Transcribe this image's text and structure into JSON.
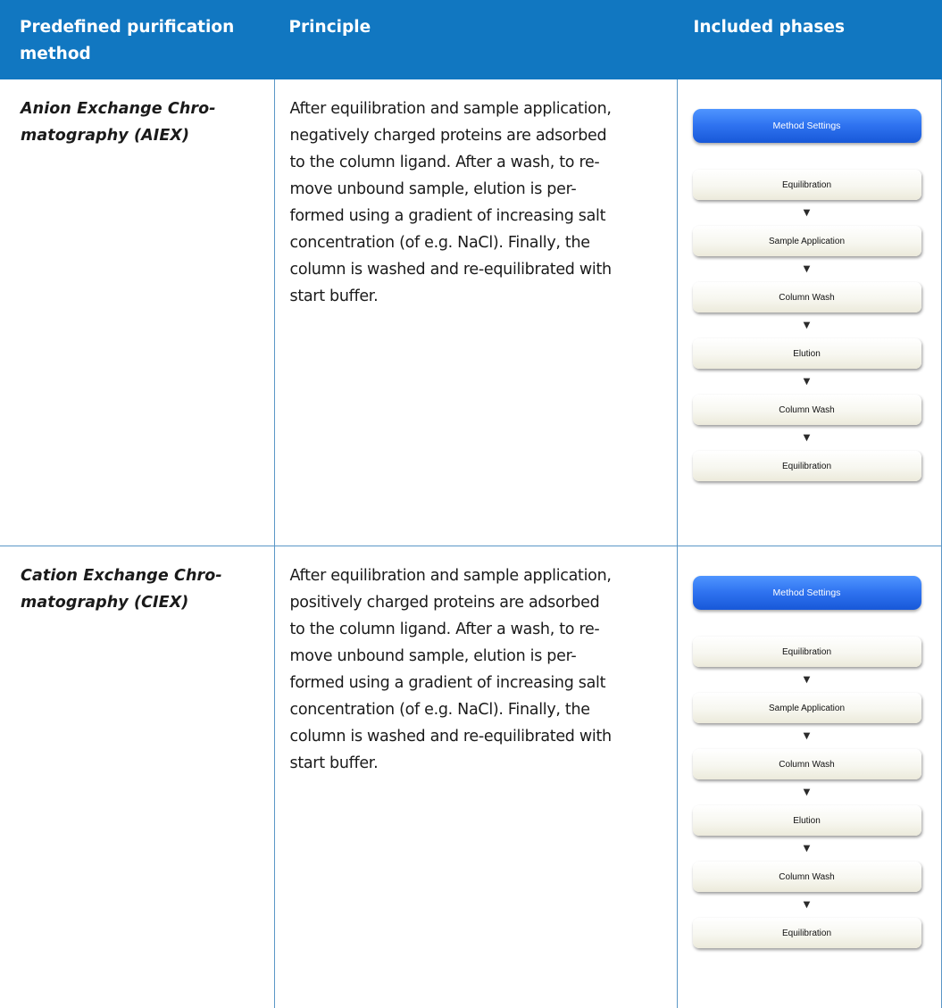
{
  "table": {
    "headers": [
      "Predefined purification method",
      "Principle",
      "Included phases"
    ],
    "rows": [
      {
        "method": "Anion Exchange Chro-\nmatography (AIEX)",
        "principle": "After equilibration and sample application, negatively charged proteins are adsorbed to the column ligand. After a wash, to re-move unbound sample, elution is per-formed using a gradient of increasing salt concentration (of e.g. NaCl). Finally, the column is washed and re-equilibrated with start buffer.",
        "settings_label": "Method Settings",
        "phases": [
          "Equilibration",
          "Sample Application",
          "Column Wash",
          "Elution",
          "Column Wash",
          "Equilibration"
        ]
      },
      {
        "method": "Cation Exchange Chro-\nmatography (CIEX)",
        "principle": "After equilibration and sample application, positively charged proteins are adsorbed to the column ligand. After a wash, to re-move unbound sample, elution is per-formed using a gradient of increasing salt concentration (of e.g. NaCl). Finally, the column is washed and re-equilibrated with start buffer.",
        "settings_label": "Method Settings",
        "phases": [
          "Equilibration",
          "Sample Application",
          "Column Wash",
          "Elution",
          "Column Wash",
          "Equilibration"
        ]
      }
    ]
  },
  "arrow_glyph": "▼",
  "colors": {
    "header_bg": "#1177c1",
    "header_text": "#ffffff",
    "grid_line": "#5b97c7",
    "settings_button": "#2f73f0"
  }
}
